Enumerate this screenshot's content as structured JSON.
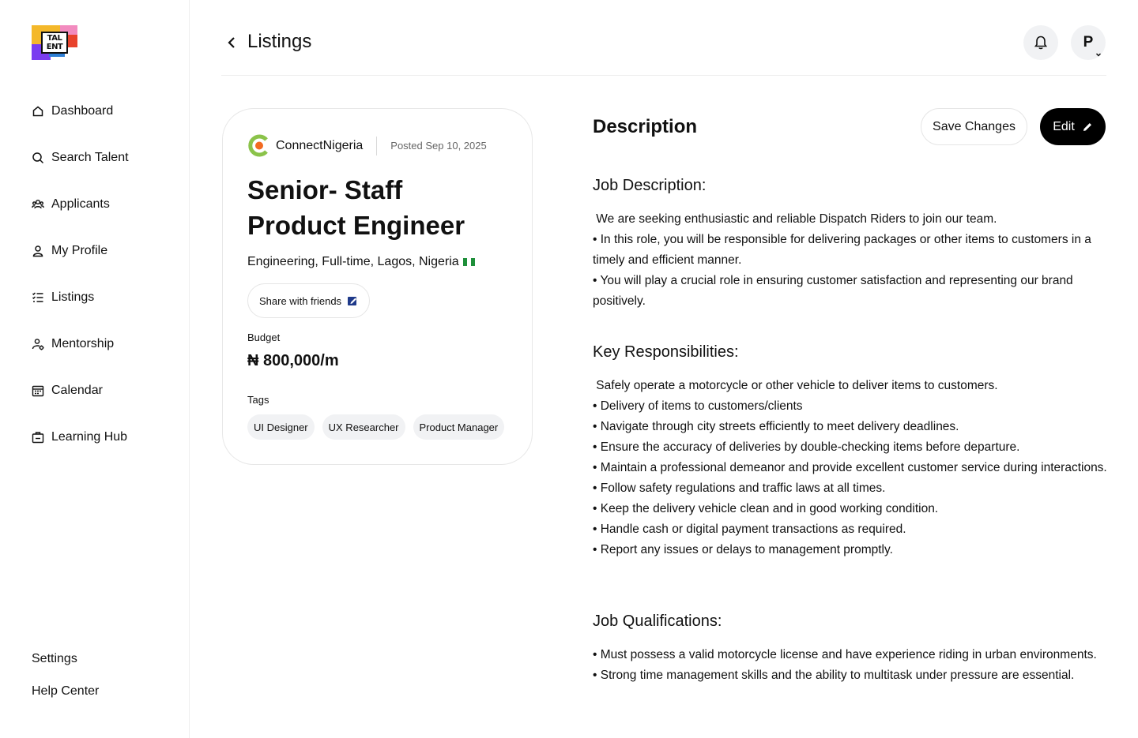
{
  "brand": {
    "logo_text": "TAL ENT"
  },
  "sidebar": {
    "items": [
      {
        "label": "Dashboard",
        "icon": "home-icon"
      },
      {
        "label": "Search Talent",
        "icon": "search-icon"
      },
      {
        "label": "Applicants",
        "icon": "users-icon"
      },
      {
        "label": "My Profile",
        "icon": "user-icon"
      },
      {
        "label": "Listings",
        "icon": "list-icon"
      },
      {
        "label": "Mentorship",
        "icon": "mentorship-icon"
      },
      {
        "label": "Calendar",
        "icon": "calendar-icon"
      },
      {
        "label": "Learning Hub",
        "icon": "briefcase-icon"
      }
    ],
    "bottom": {
      "settings": "Settings",
      "help": "Help Center"
    }
  },
  "header": {
    "title": "Listings",
    "avatar_initial": "P"
  },
  "job": {
    "company": "ConnectNigeria",
    "posted": "Posted Sep 10, 2025",
    "title": "Senior- Staff Product Engineer",
    "meta": "Engineering, Full-time, Lagos, Nigeria",
    "share_label": "Share with friends",
    "budget_label": "Budget",
    "budget_value": "₦ 800,000/m",
    "tags_label": "Tags",
    "tags": [
      "UI Designer",
      "UX Researcher",
      "Product Manager"
    ]
  },
  "description": {
    "title": "Description",
    "save_label": "Save Changes",
    "edit_label": "Edit",
    "sections": [
      {
        "heading": "Job Description:",
        "lines": [
          " We are seeking enthusiastic and reliable Dispatch Riders to join our team.",
          "• In this role, you will be responsible for delivering packages or other items to customers in a timely and efficient manner.",
          "• You will play a crucial role in ensuring customer satisfaction and representing our brand positively."
        ]
      },
      {
        "heading": "Key Responsibilities:",
        "lines": [
          " Safely operate a motorcycle or other vehicle to deliver items to customers.",
          "• Delivery of items to customers/clients",
          "• Navigate through city streets efficiently to meet delivery deadlines.",
          "• Ensure the accuracy of deliveries by double-checking items before departure.",
          "• Maintain a professional demeanor and provide excellent customer service during interactions.",
          "• Follow safety regulations and traffic laws at all times.",
          "• Keep the delivery vehicle clean and in good working condition.",
          "• Handle cash or digital payment transactions as required.",
          "• Report any issues or delays to management promptly."
        ]
      },
      {
        "heading": "Job Qualifications:",
        "lines": [
          "• Must possess a valid motorcycle license and have experience riding in urban environments.",
          "• Strong time management skills and the ability to multitask under pressure are essential."
        ]
      }
    ]
  },
  "colors": {
    "primary": "#000000",
    "chip_bg": "#f1f2f4",
    "company_green": "#8bc34a",
    "company_orange": "#f26a21"
  }
}
